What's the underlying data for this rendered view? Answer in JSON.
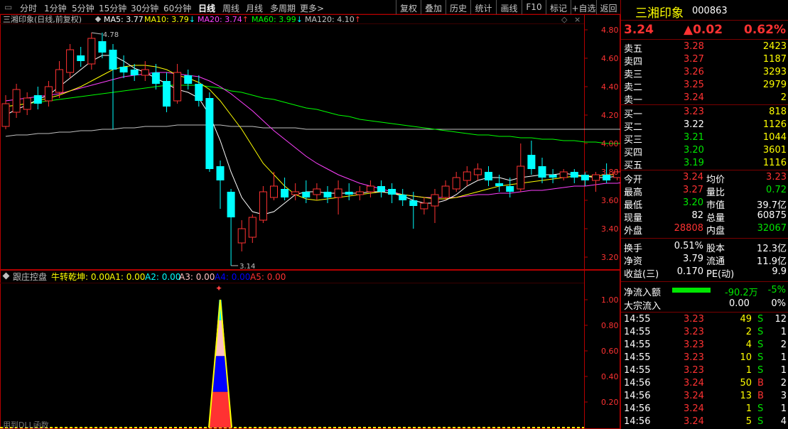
{
  "toolbar": {
    "periods": [
      "分时",
      "1分钟",
      "5分钟",
      "15分钟",
      "30分钟",
      "60分钟",
      "日线",
      "周线",
      "月线",
      "多周期",
      "更多>"
    ],
    "active_period": "日线",
    "buttons": [
      "复权",
      "叠加",
      "历史",
      "统计",
      "画线",
      "F10",
      "标记",
      "+自选",
      "返回"
    ]
  },
  "main_chart": {
    "stock_label": "三湘印象(日线,前复权)",
    "ma": [
      {
        "label": "MA5: 3.77",
        "color": "#ffffff"
      },
      {
        "label": "MA10: 3.79",
        "arrow": "↓",
        "arrow_color": "#00ffff",
        "color": "#ffff00"
      },
      {
        "label": "MA20: 3.74",
        "arrow": "↑",
        "arrow_color": "#ff3232",
        "color": "#ff40ff"
      },
      {
        "label": "MA60: 3.99",
        "arrow": "↓",
        "arrow_color": "#00ffff",
        "color": "#00ff00"
      },
      {
        "label": "MA120: 4.10",
        "arrow": "↑",
        "arrow_color": "#ff3232",
        "color": "#c0c0c0"
      }
    ],
    "high_label": "4.78",
    "low_label": "3.14",
    "y_ticks": [
      "4.80",
      "4.60",
      "4.40",
      "4.20",
      "4.00",
      "3.80",
      "3.60",
      "3.40",
      "3.20"
    ]
  },
  "chart_data": {
    "type": "candlestick",
    "ylim": [
      3.12,
      4.84
    ],
    "candles": [
      [
        4.12,
        4.28,
        4.34,
        4.1
      ],
      [
        4.22,
        4.38,
        4.42,
        4.18
      ],
      [
        4.24,
        4.32,
        4.36,
        4.2
      ],
      [
        4.34,
        4.28,
        4.4,
        4.24
      ],
      [
        4.3,
        4.4,
        4.44,
        4.26
      ],
      [
        4.36,
        4.52,
        4.58,
        4.32
      ],
      [
        4.5,
        4.66,
        4.7,
        4.46
      ],
      [
        4.62,
        4.58,
        4.68,
        4.54
      ],
      [
        4.56,
        4.74,
        4.78,
        4.52
      ],
      [
        4.72,
        4.64,
        4.78,
        4.6
      ],
      [
        4.66,
        4.52,
        4.7,
        4.1
      ],
      [
        4.54,
        4.5,
        4.62,
        4.46
      ],
      [
        4.52,
        4.48,
        4.56,
        4.44
      ],
      [
        4.48,
        4.52,
        4.58,
        4.44
      ],
      [
        4.5,
        4.42,
        4.56,
        4.38
      ],
      [
        4.44,
        4.26,
        4.5,
        4.22
      ],
      [
        4.3,
        4.5,
        4.56,
        4.28
      ],
      [
        4.48,
        4.42,
        4.52,
        4.38
      ],
      [
        4.42,
        4.3,
        4.48,
        4.26
      ],
      [
        4.32,
        3.82,
        4.36,
        3.8
      ],
      [
        3.84,
        3.74,
        3.88,
        3.54
      ],
      [
        3.66,
        3.48,
        3.68,
        3.14
      ],
      [
        3.3,
        3.4,
        3.46,
        3.24
      ],
      [
        3.34,
        3.48,
        3.5,
        3.3
      ],
      [
        3.46,
        3.66,
        3.7,
        3.44
      ],
      [
        3.62,
        3.7,
        3.8,
        3.6
      ],
      [
        3.68,
        3.62,
        3.76,
        3.6
      ],
      [
        3.64,
        3.66,
        3.72,
        3.6
      ],
      [
        3.66,
        3.62,
        3.74,
        3.58
      ],
      [
        3.64,
        3.68,
        3.72,
        3.6
      ],
      [
        3.66,
        3.62,
        3.7,
        3.58
      ],
      [
        3.62,
        3.68,
        3.74,
        3.5
      ],
      [
        3.66,
        3.64,
        3.72,
        3.6
      ],
      [
        3.64,
        3.66,
        3.7,
        3.6
      ],
      [
        3.66,
        3.7,
        3.74,
        3.62
      ],
      [
        3.7,
        3.66,
        3.74,
        3.62
      ],
      [
        3.68,
        3.64,
        3.72,
        3.58
      ],
      [
        3.64,
        3.6,
        3.68,
        3.56
      ],
      [
        3.6,
        3.56,
        3.66,
        3.4
      ],
      [
        3.54,
        3.58,
        3.62,
        3.5
      ],
      [
        3.56,
        3.64,
        3.68,
        3.44
      ],
      [
        3.62,
        3.7,
        3.74,
        3.6
      ],
      [
        3.68,
        3.76,
        3.8,
        3.66
      ],
      [
        3.74,
        3.8,
        3.84,
        3.7
      ],
      [
        3.78,
        3.82,
        3.86,
        3.74
      ],
      [
        3.8,
        3.74,
        3.84,
        3.7
      ],
      [
        3.72,
        3.7,
        3.78,
        3.66
      ],
      [
        3.7,
        3.66,
        3.76,
        3.62
      ],
      [
        3.68,
        3.84,
        4.0,
        3.66
      ],
      [
        3.92,
        3.82,
        4.02,
        3.78
      ],
      [
        3.84,
        3.76,
        3.9,
        3.72
      ],
      [
        3.78,
        3.76,
        3.82,
        3.72
      ],
      [
        3.76,
        3.8,
        3.82,
        3.74
      ],
      [
        3.8,
        3.76,
        3.82,
        3.72
      ],
      [
        3.78,
        3.74,
        3.8,
        3.7
      ],
      [
        3.74,
        3.78,
        3.8,
        3.66
      ],
      [
        3.78,
        3.74,
        3.86,
        3.72
      ],
      [
        3.76,
        3.8,
        3.82,
        3.74
      ],
      [
        3.78,
        3.8,
        3.82,
        3.74
      ],
      [
        3.8,
        3.79,
        3.84,
        3.74
      ],
      [
        3.79,
        3.8,
        3.84,
        3.72
      ]
    ],
    "ma5": [
      4.2,
      4.24,
      4.27,
      4.31,
      4.34,
      4.4,
      4.46,
      4.52,
      4.58,
      4.62,
      4.62,
      4.58,
      4.53,
      4.5,
      4.46,
      4.42,
      4.38,
      4.36,
      4.32,
      4.2,
      4.02,
      3.8,
      3.62,
      3.52,
      3.5,
      3.52,
      3.58,
      3.64,
      3.66,
      3.66,
      3.65,
      3.65,
      3.65,
      3.65,
      3.66,
      3.66,
      3.65,
      3.63,
      3.6,
      3.58,
      3.58,
      3.6,
      3.64,
      3.7,
      3.74,
      3.76,
      3.76,
      3.74,
      3.76,
      3.77,
      3.78,
      3.78,
      3.79,
      3.78,
      3.77,
      3.76,
      3.76,
      3.77,
      3.78,
      3.78,
      3.77
    ],
    "ma10": [
      4.26,
      4.27,
      4.28,
      4.3,
      4.32,
      4.34,
      4.37,
      4.4,
      4.44,
      4.48,
      4.52,
      4.54,
      4.55,
      4.55,
      4.54,
      4.52,
      4.48,
      4.46,
      4.43,
      4.38,
      4.3,
      4.2,
      4.1,
      3.98,
      3.86,
      3.78,
      3.7,
      3.64,
      3.61,
      3.6,
      3.61,
      3.62,
      3.63,
      3.64,
      3.65,
      3.66,
      3.65,
      3.64,
      3.63,
      3.62,
      3.61,
      3.61,
      3.62,
      3.64,
      3.66,
      3.68,
      3.7,
      3.71,
      3.72,
      3.73,
      3.74,
      3.75,
      3.76,
      3.77,
      3.77,
      3.77,
      3.78,
      3.78,
      3.79,
      3.79,
      3.79
    ],
    "ma20": [
      4.3,
      4.31,
      4.32,
      4.33,
      4.34,
      4.35,
      4.37,
      4.39,
      4.41,
      4.43,
      4.45,
      4.47,
      4.48,
      4.49,
      4.5,
      4.5,
      4.49,
      4.48,
      4.47,
      4.44,
      4.4,
      4.35,
      4.29,
      4.23,
      4.16,
      4.09,
      4.03,
      3.97,
      3.91,
      3.86,
      3.82,
      3.78,
      3.75,
      3.72,
      3.7,
      3.68,
      3.66,
      3.64,
      3.63,
      3.62,
      3.62,
      3.62,
      3.62,
      3.63,
      3.64,
      3.64,
      3.65,
      3.65,
      3.66,
      3.67,
      3.67,
      3.68,
      3.69,
      3.7,
      3.7,
      3.71,
      3.72,
      3.72,
      3.73,
      3.73,
      3.74
    ],
    "ma60": [
      4.26,
      4.27,
      4.28,
      4.29,
      4.3,
      4.31,
      4.32,
      4.33,
      4.34,
      4.35,
      4.36,
      4.37,
      4.38,
      4.39,
      4.4,
      4.41,
      4.41,
      4.41,
      4.41,
      4.4,
      4.39,
      4.37,
      4.36,
      4.34,
      4.32,
      4.31,
      4.29,
      4.27,
      4.25,
      4.24,
      4.22,
      4.2,
      4.19,
      4.17,
      4.16,
      4.15,
      4.14,
      4.13,
      4.12,
      4.11,
      4.1,
      4.09,
      4.08,
      4.07,
      4.06,
      4.06,
      4.05,
      4.05,
      4.04,
      4.04,
      4.03,
      4.03,
      4.02,
      4.02,
      4.01,
      4.01,
      4.0,
      4.0,
      4.0,
      3.99,
      3.99
    ],
    "ma120": [
      4.05,
      4.06,
      4.06,
      4.07,
      4.07,
      4.08,
      4.08,
      4.09,
      4.09,
      4.1,
      4.1,
      4.11,
      4.11,
      4.12,
      4.12,
      4.12,
      4.13,
      4.13,
      4.13,
      4.13,
      4.13,
      4.12,
      4.12,
      4.12,
      4.11,
      4.11,
      4.11,
      4.11,
      4.1,
      4.1,
      4.1,
      4.1,
      4.1,
      4.1,
      4.1,
      4.1,
      4.1,
      4.1,
      4.1,
      4.1,
      4.1,
      4.1,
      4.1,
      4.1,
      4.1,
      4.1,
      4.1,
      4.1,
      4.1,
      4.1,
      4.1,
      4.1,
      4.1,
      4.1,
      4.1,
      4.1,
      4.1,
      4.1,
      4.1,
      4.1,
      4.1
    ],
    "indicator": {
      "type": "area",
      "ylim": [
        0,
        1.1
      ],
      "peak_index": 20,
      "peak_value": 1.0,
      "y_ticks": [
        "1.00",
        "0.80",
        "0.60",
        "0.40",
        "0.20"
      ]
    }
  },
  "indicator": {
    "name": "跟庄控盘",
    "fields": [
      {
        "label": "牛转乾坤: 0.00",
        "color": "#ffff00"
      },
      {
        "label": "A1: 0.00",
        "color": "#ffff00"
      },
      {
        "label": "A2: 0.00",
        "color": "#00ffff"
      },
      {
        "label": "A3: 0.00",
        "color": "#ffc0c0"
      },
      {
        "label": "A4: 0.00",
        "color": "#0000ff"
      },
      {
        "label": "A5: 0.00",
        "color": "#ff3232"
      }
    ],
    "footer": "用到DLL函数"
  },
  "quote": {
    "name": "三湘印象",
    "code": "000863",
    "price": "3.24",
    "change": "▲0.02",
    "pct": "0.62%",
    "sells": [
      {
        "label": "卖五",
        "price": "3.28",
        "vol": "2423"
      },
      {
        "label": "卖四",
        "price": "3.27",
        "vol": "1187"
      },
      {
        "label": "卖三",
        "price": "3.26",
        "vol": "3293"
      },
      {
        "label": "卖二",
        "price": "3.25",
        "vol": "2979"
      },
      {
        "label": "卖一",
        "price": "3.24",
        "vol": "2"
      }
    ],
    "buys": [
      {
        "label": "买一",
        "price": "3.23",
        "vol": "818"
      },
      {
        "label": "买二",
        "price": "3.22",
        "vol": "1126"
      },
      {
        "label": "买三",
        "price": "3.21",
        "vol": "1044"
      },
      {
        "label": "买四",
        "price": "3.20",
        "vol": "3601"
      },
      {
        "label": "买五",
        "price": "3.19",
        "vol": "1116"
      }
    ],
    "stats1": [
      {
        "l1": "今开",
        "v1": "3.24",
        "l2": "均价",
        "v2": "3.23"
      },
      {
        "l1": "最高",
        "v1": "3.27",
        "l2": "量比",
        "v2": "0.72"
      },
      {
        "l1": "最低",
        "v1": "3.20",
        "l2": "市值",
        "v2": "39.7亿"
      },
      {
        "l1": "现量",
        "v1": "82",
        "l2": "总量",
        "v2": "60875"
      },
      {
        "l1": "外盘",
        "v1": "28808",
        "l2": "内盘",
        "v2": "32067"
      }
    ],
    "stats2": [
      {
        "l1": "换手",
        "v1": "0.51%",
        "l2": "股本",
        "v2": "12.3亿"
      },
      {
        "l1": "净资",
        "v1": "3.79",
        "l2": "流通",
        "v2": "11.9亿"
      },
      {
        "l1": "收益(三)",
        "v1": "0.170",
        "l2": "PE(动)",
        "v2": "9.9"
      }
    ],
    "flow": {
      "net_label": "净流入额",
      "net_value": "-90.2万",
      "net_pct": "-5%",
      "big_label": "大宗流入",
      "big_value": "0.00",
      "big_pct": "0%"
    },
    "ticks": [
      {
        "time": "14:55",
        "price": "3.23",
        "vol": "49",
        "side": "S",
        "n": "12"
      },
      {
        "time": "14:55",
        "price": "3.23",
        "vol": "2",
        "side": "S",
        "n": "1"
      },
      {
        "time": "14:55",
        "price": "3.23",
        "vol": "4",
        "side": "S",
        "n": "2"
      },
      {
        "time": "14:55",
        "price": "3.23",
        "vol": "10",
        "side": "S",
        "n": "1"
      },
      {
        "time": "14:55",
        "price": "3.23",
        "vol": "1",
        "side": "S",
        "n": "1"
      },
      {
        "time": "14:56",
        "price": "3.24",
        "vol": "50",
        "side": "B",
        "n": "2"
      },
      {
        "time": "14:56",
        "price": "3.24",
        "vol": "13",
        "side": "B",
        "n": "3"
      },
      {
        "time": "14:56",
        "price": "3.24",
        "vol": "1",
        "side": "S",
        "n": "1"
      },
      {
        "time": "14:56",
        "price": "3.24",
        "vol": "5",
        "side": "S",
        "n": "4"
      }
    ]
  },
  "colors": {
    "up": "#ff3232",
    "down": "#00ffff",
    "axis": "#b40000",
    "ma5": "#ffffff",
    "ma10": "#ffff00",
    "ma20": "#ff40ff",
    "ma60": "#00ff00",
    "ma120": "#c0c0c0"
  }
}
